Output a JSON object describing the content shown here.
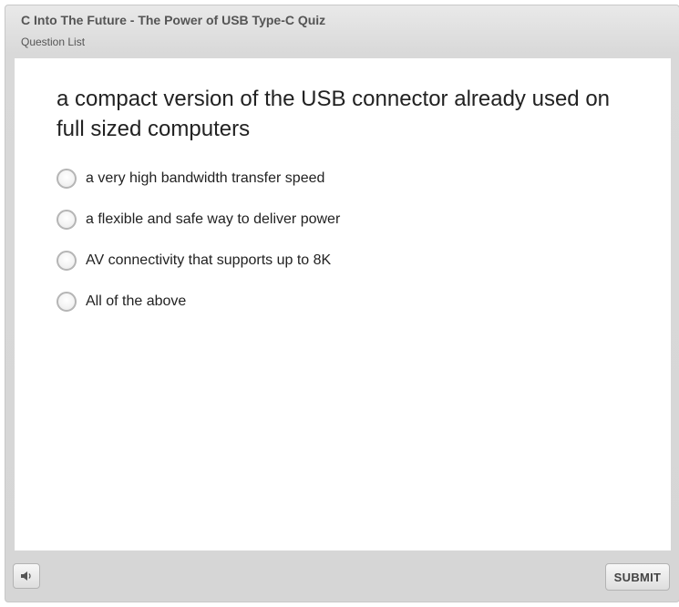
{
  "header": {
    "title": "C Into The Future - The Power of USB Type-C Quiz",
    "menu_link": "Question List"
  },
  "question": {
    "text": "a compact version of the USB connector already used on full sized computers",
    "choices": [
      {
        "label": "a very high bandwidth transfer speed",
        "selected": false
      },
      {
        "label": "a flexible and safe way to deliver power",
        "selected": false
      },
      {
        "label": "AV connectivity that supports up to 8K",
        "selected": false
      },
      {
        "label": "All of the above",
        "selected": false
      }
    ]
  },
  "footer": {
    "volume_icon": "speaker-icon",
    "submit_label": "SUBMIT"
  },
  "colors": {
    "chrome": "#d6d6d6",
    "slide": "#ffffff",
    "text": "#222222"
  }
}
